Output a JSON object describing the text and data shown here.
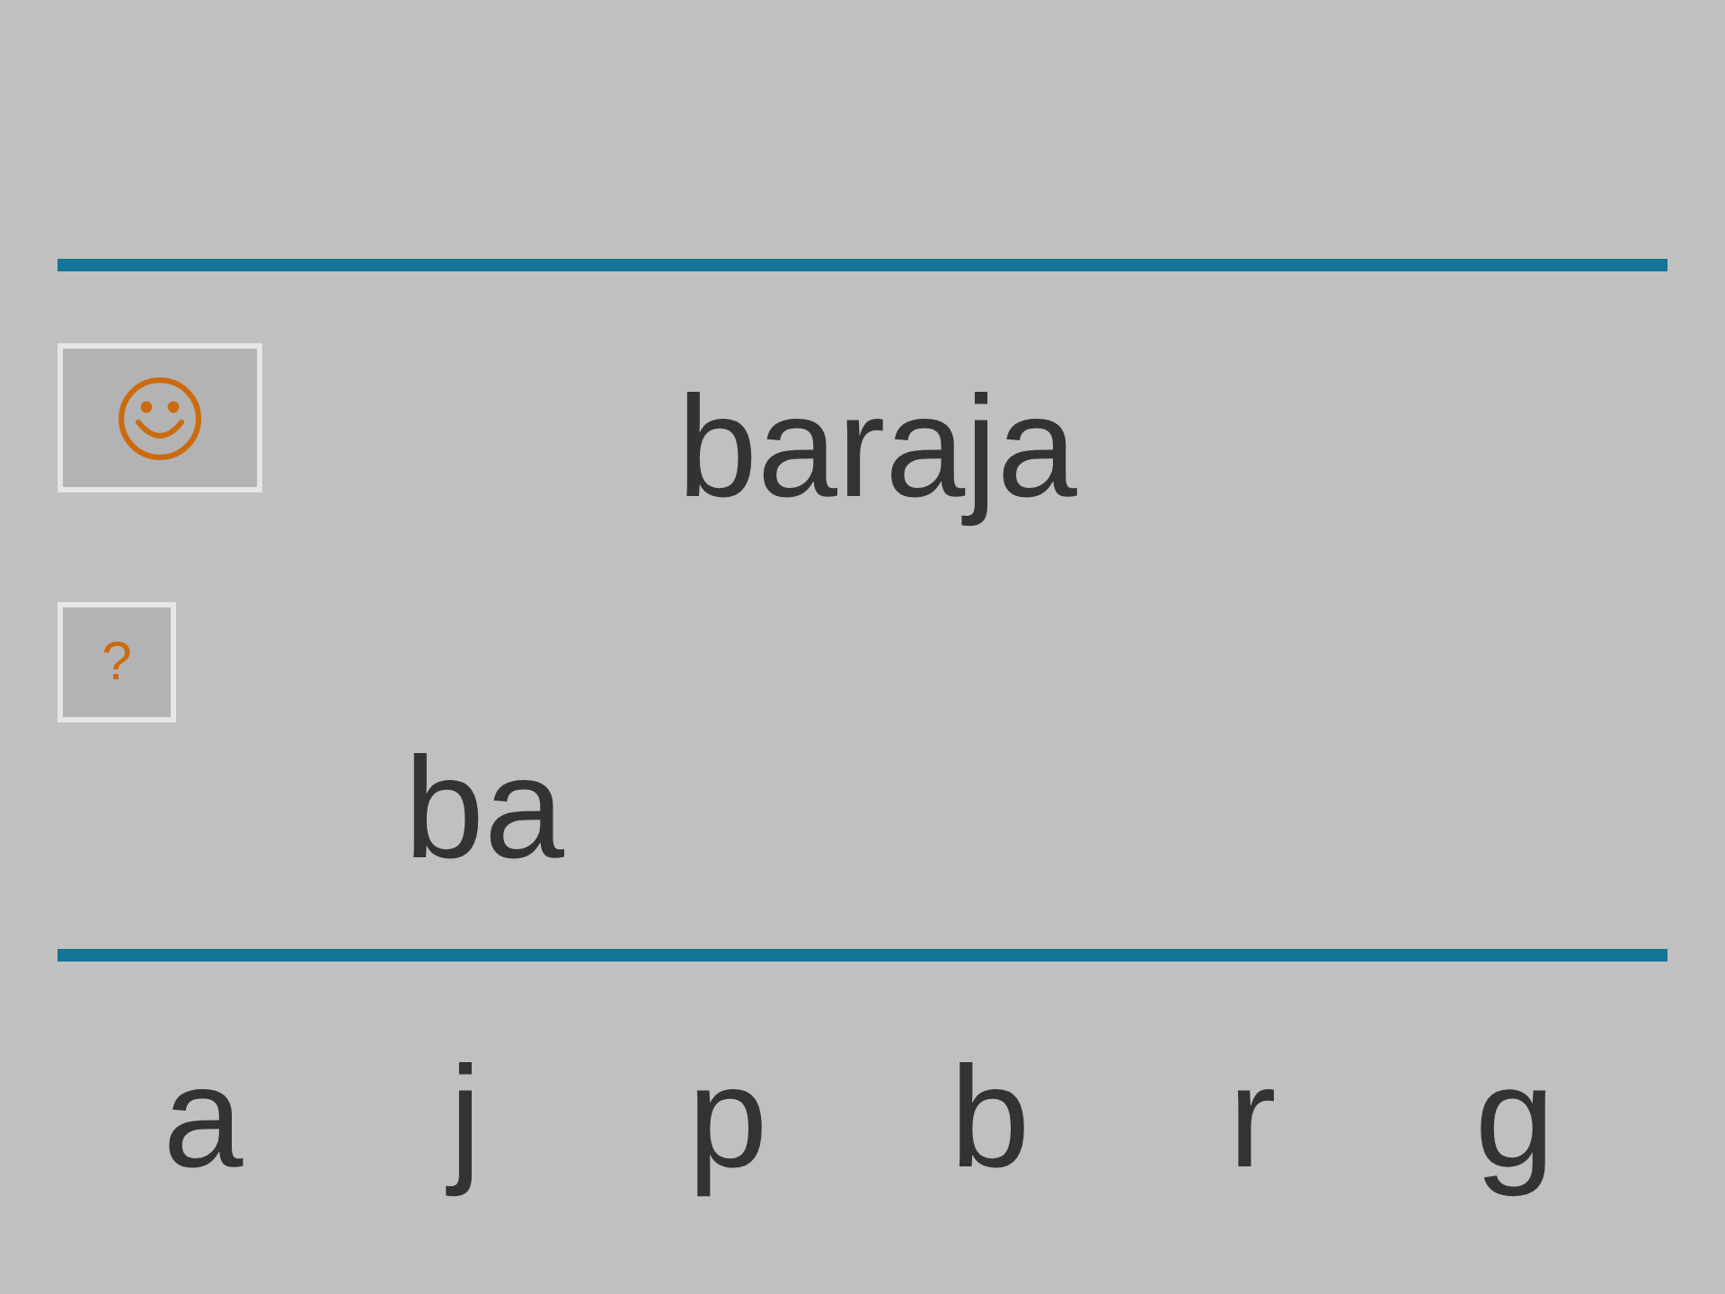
{
  "target_word": "baraja",
  "help_button": {
    "label": "?"
  },
  "answer_text": "ba",
  "letters": [
    "a",
    "j",
    "p",
    "b",
    "r",
    "g"
  ]
}
